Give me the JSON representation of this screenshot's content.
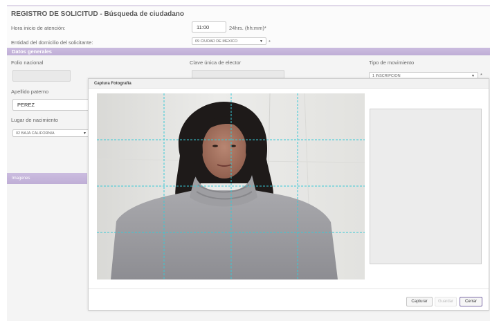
{
  "page": {
    "title": "REGISTRO DE SOLICITUD - Búsqueda de ciudadano"
  },
  "form": {
    "hora_label": "Hora inicio de atención:",
    "hora_value": "11:00",
    "hora_format": "24hrs. (hh:mm)*",
    "entidad_label": "Entidad del domicilio del solicitante:",
    "entidad_value": "09 CIUDAD DE MEXICO",
    "entidad_required": "*"
  },
  "datos_generales": {
    "section_title": "Datos generales",
    "folio_label": "Folio nacional",
    "clave_label": "Clave única de elector",
    "tipo_label": "Tipo de movimiento",
    "tipo_value": "1 INSCRIPCION",
    "tipo_required": "*",
    "apellido_label": "Apellido paterno",
    "apellido_value": "PEREZ",
    "lugar_label": "Lugar de nacimiento",
    "lugar_value": "02 BAJA CALIFORNIA"
  },
  "imagenes": {
    "section_title": "Imagenes"
  },
  "modal": {
    "title": "Captura Fotografía",
    "buttons": {
      "capturar": "Capturar",
      "guardar": "Guardar",
      "cerrar": "Cerrar"
    }
  },
  "colors": {
    "accent": "#c5b5dc",
    "grid": "#38c9d6"
  },
  "icons": {
    "select_arrow": "chevron-down-icon"
  }
}
